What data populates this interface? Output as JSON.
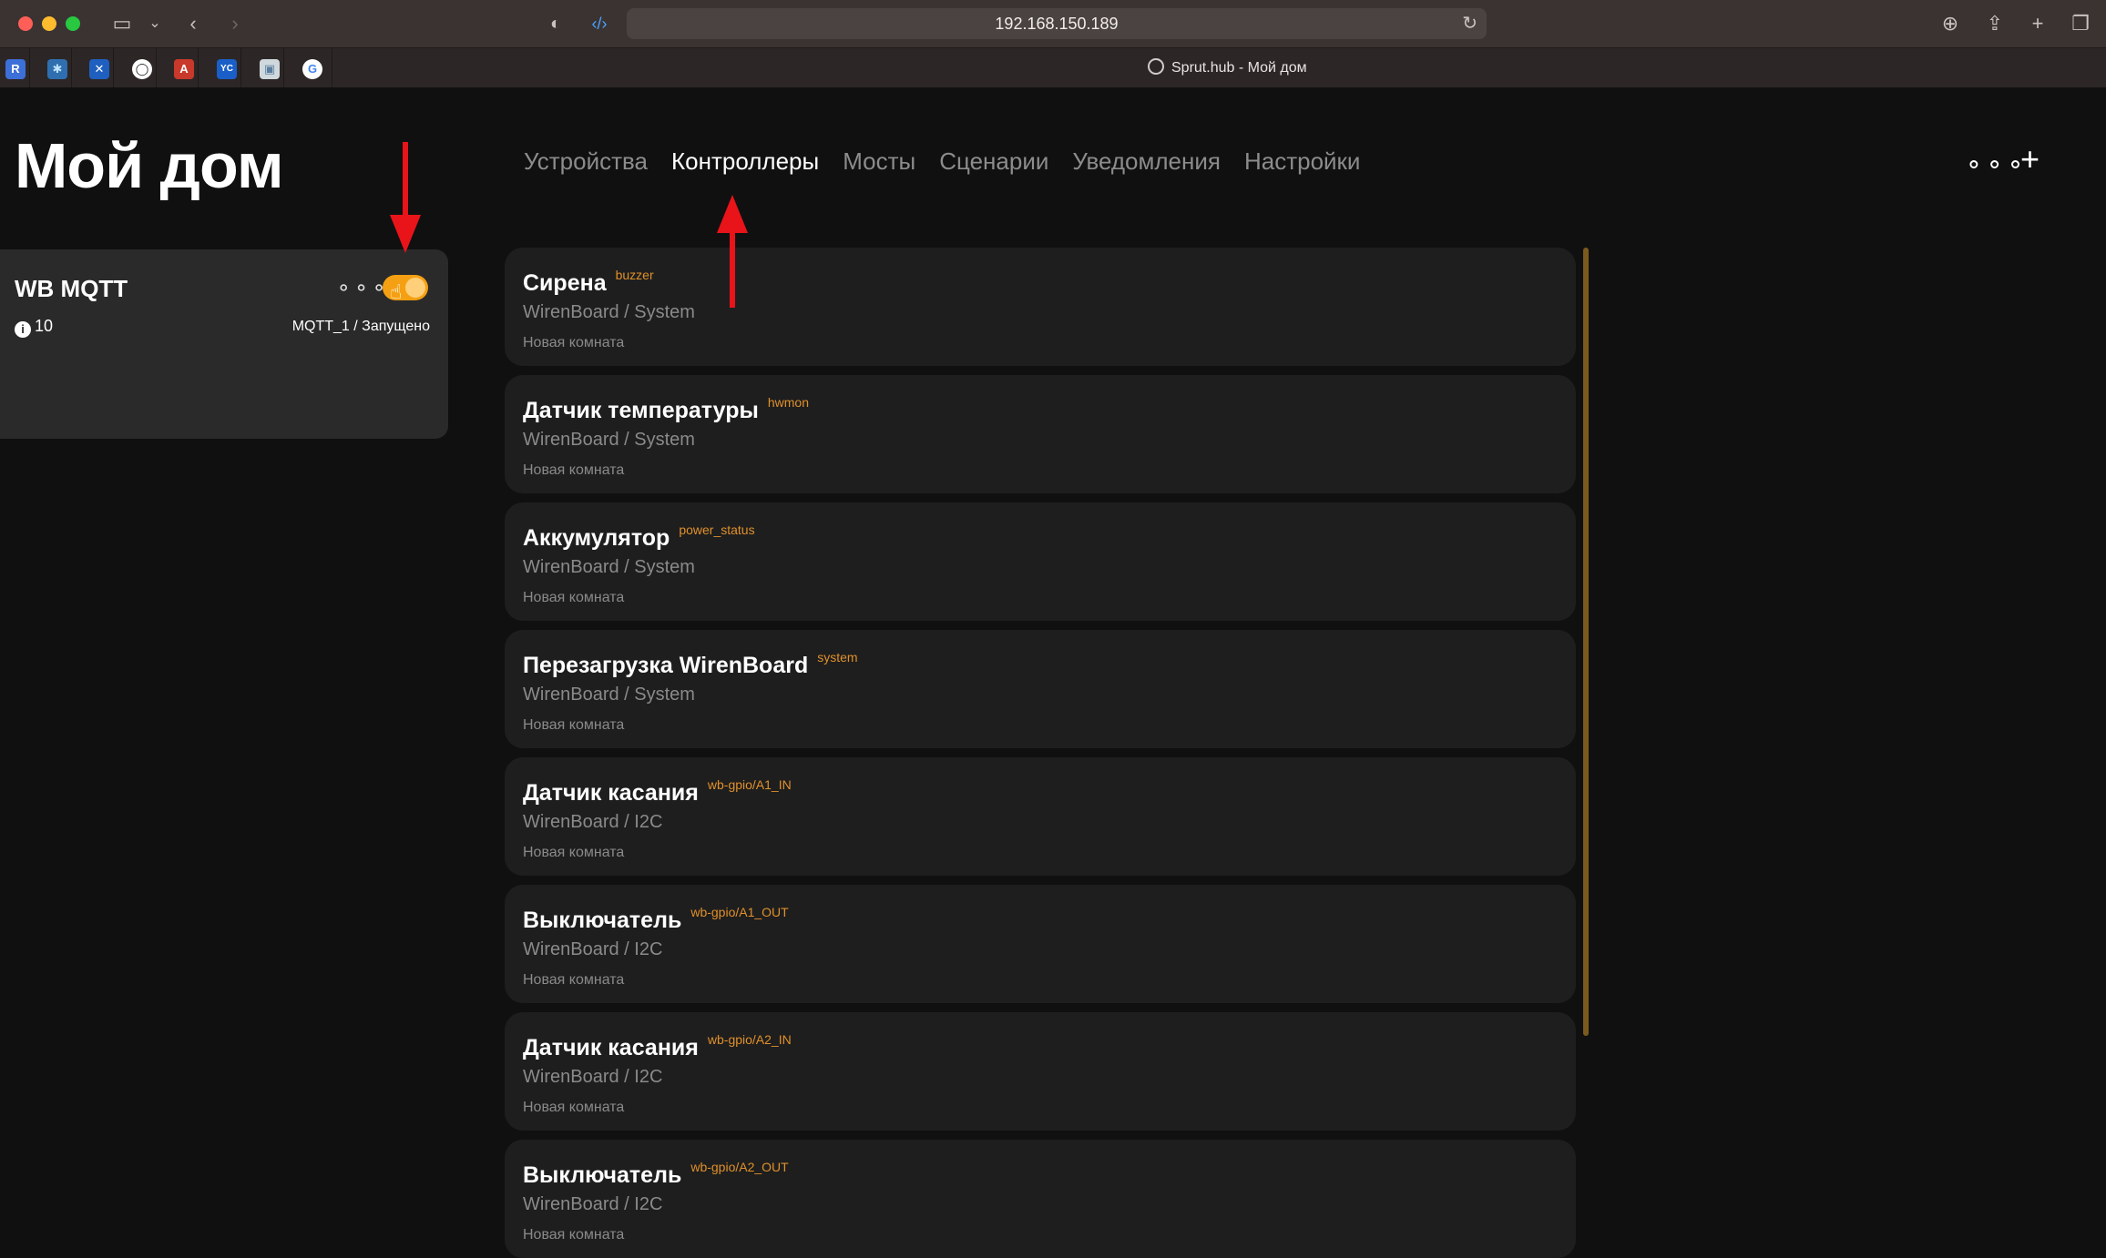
{
  "browser": {
    "url": "192.168.150.189",
    "tab_title": "Sprut.hub - Мой дом",
    "favorites": [
      "R",
      "✱",
      "✕",
      "◯",
      "A",
      "YC",
      "▣",
      "G"
    ]
  },
  "app": {
    "title": "Мой дом",
    "nav": [
      {
        "label": "Устройства"
      },
      {
        "label": "Контроллеры"
      },
      {
        "label": "Мосты"
      },
      {
        "label": "Сценарии"
      },
      {
        "label": "Уведомления"
      },
      {
        "label": "Настройки"
      }
    ],
    "more_label": "⚬⚬⚬",
    "plus_label": "+"
  },
  "controller": {
    "name": "WB MQTT",
    "more_label": "⚬⚬⚬",
    "toggle_on": true,
    "count": "10",
    "status": "MQTT_1 / Запущено"
  },
  "devices": [
    {
      "name": "Сирена",
      "tag": "buzzer",
      "path": "WirenBoard / System",
      "room": "Новая комната"
    },
    {
      "name": "Датчик температуры",
      "tag": "hwmon",
      "path": "WirenBoard / System",
      "room": "Новая комната"
    },
    {
      "name": "Аккумулятор",
      "tag": "power_status",
      "path": "WirenBoard / System",
      "room": "Новая комната"
    },
    {
      "name": "Перезагрузка WirenBoard",
      "tag": "system",
      "path": "WirenBoard / System",
      "room": "Новая комната"
    },
    {
      "name": "Датчик касания",
      "tag": "wb-gpio/A1_IN",
      "path": "WirenBoard / I2C",
      "room": "Новая комната"
    },
    {
      "name": "Выключатель",
      "tag": "wb-gpio/A1_OUT",
      "path": "WirenBoard / I2C",
      "room": "Новая комната"
    },
    {
      "name": "Датчик касания",
      "tag": "wb-gpio/A2_IN",
      "path": "WirenBoard / I2C",
      "room": "Новая комната"
    },
    {
      "name": "Выключатель",
      "tag": "wb-gpio/A2_OUT",
      "path": "WirenBoard / I2C",
      "room": "Новая комната"
    }
  ],
  "colors": {
    "accent": "#f5a013",
    "tag": "#e0902b",
    "annotation": "#e8141a"
  }
}
